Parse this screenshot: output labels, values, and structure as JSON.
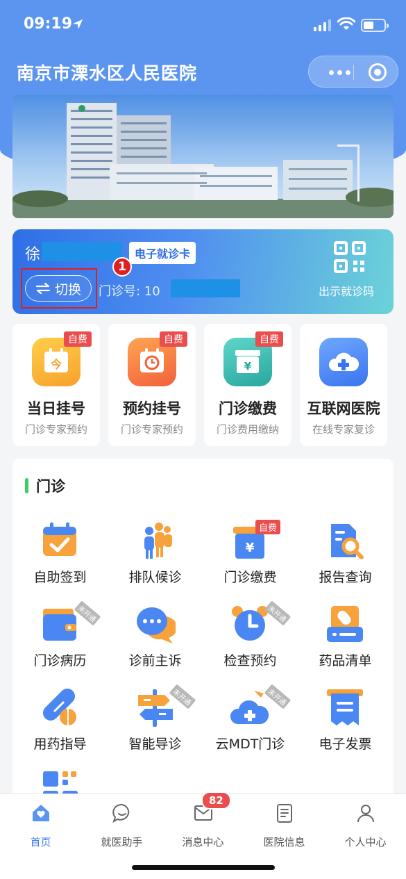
{
  "status_bar": {
    "time": "09:19"
  },
  "header": {
    "title": "南京市溧水区人民医院"
  },
  "card": {
    "name_initial": "徐",
    "tag": "电子就诊卡",
    "step_number": "1",
    "switch_label": "切换",
    "clinic_label": "门诊号: 10",
    "qr_label": "出示就诊码"
  },
  "quick_actions": [
    {
      "title": "当日挂号",
      "sub": "门诊专家预约",
      "badge": "自费"
    },
    {
      "title": "预约挂号",
      "sub": "门诊专家预约",
      "badge": "自费"
    },
    {
      "title": "门诊缴费",
      "sub": "门诊费用缴纳",
      "badge": "自费"
    },
    {
      "title": "互联网医院",
      "sub": "在线专家复诊",
      "badge": ""
    }
  ],
  "outpatient": {
    "title": "门诊",
    "items": [
      {
        "label": "自助签到"
      },
      {
        "label": "排队候诊"
      },
      {
        "label": "门诊缴费",
        "tag": "自费"
      },
      {
        "label": "报告查询"
      },
      {
        "label": "门诊病历",
        "tag": "未开通"
      },
      {
        "label": "诊前主诉"
      },
      {
        "label": "检查预约",
        "tag": "未开通"
      },
      {
        "label": "药品清单"
      },
      {
        "label": "用药指导"
      },
      {
        "label": "智能导诊",
        "tag": "未开通"
      },
      {
        "label": "云MDT门诊",
        "tag": "未开通"
      },
      {
        "label": "电子发票"
      }
    ]
  },
  "tabbar": {
    "tabs": [
      {
        "label": "首页"
      },
      {
        "label": "就医助手"
      },
      {
        "label": "消息中心",
        "badge": "82"
      },
      {
        "label": "医院信息"
      },
      {
        "label": "个人中心"
      }
    ]
  },
  "colors": {
    "primary": "#5b95f0",
    "accent": "#3d7ef0",
    "badge_red": "#e94d4d",
    "section_bar": "#3ecc65"
  }
}
